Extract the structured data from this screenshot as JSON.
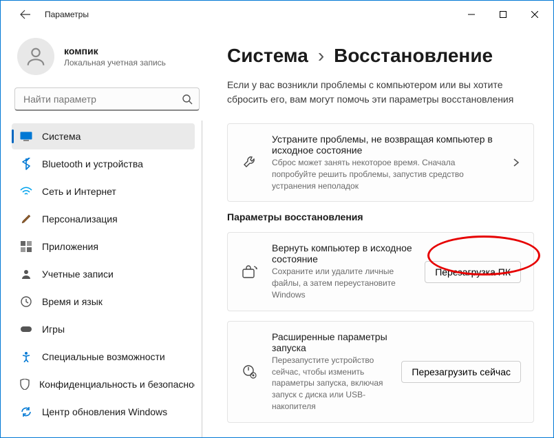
{
  "window": {
    "title": "Параметры"
  },
  "account": {
    "name": "компик",
    "sub": "Локальная учетная запись"
  },
  "search": {
    "placeholder": "Найти параметр"
  },
  "nav": [
    {
      "label": "Система"
    },
    {
      "label": "Bluetooth и устройства"
    },
    {
      "label": "Сеть и Интернет"
    },
    {
      "label": "Персонализация"
    },
    {
      "label": "Приложения"
    },
    {
      "label": "Учетные записи"
    },
    {
      "label": "Время и язык"
    },
    {
      "label": "Игры"
    },
    {
      "label": "Специальные возможности"
    },
    {
      "label": "Конфиденциальность и безопасность"
    },
    {
      "label": "Центр обновления Windows"
    }
  ],
  "breadcrumb": {
    "parent": "Система",
    "sep": "›",
    "current": "Восстановление"
  },
  "intro": "Если у вас возникли проблемы с компьютером или вы хотите сбросить его, вам могут помочь эти параметры восстановления",
  "troubleshoot": {
    "title": "Устраните проблемы, не возвращая компьютер в исходное состояние",
    "desc": "Сброс может занять некоторое время. Сначала попробуйте решить проблемы, запустив средство устранения неполадок"
  },
  "section": "Параметры восстановления",
  "reset": {
    "title": "Вернуть компьютер в исходное состояние",
    "desc": "Сохраните или удалите личные файлы, а затем переустановите Windows",
    "button": "Перезагрузка ПК"
  },
  "advanced": {
    "title": "Расширенные параметры запуска",
    "desc": "Перезапустите устройство сейчас, чтобы изменить параметры запуска, включая запуск с диска или USB-накопителя",
    "button": "Перезагрузить сейчас"
  }
}
